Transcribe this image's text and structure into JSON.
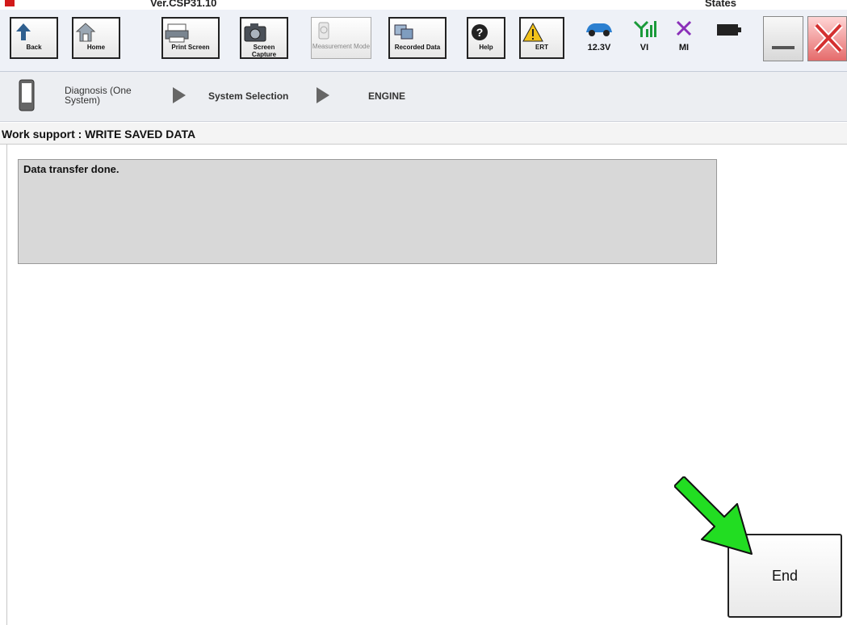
{
  "titlebar": {
    "version": "Ver.CSP31.10",
    "states": "States"
  },
  "toolbar": {
    "back": "Back",
    "home": "Home",
    "print_screen": "Print Screen",
    "screen_capture": "Screen Capture",
    "measurement_mode": "Measurement Mode",
    "recorded_data": "Recorded Data",
    "help": "Help",
    "ert": "ERT",
    "battery_voltage": "12.3V",
    "vi": "VI",
    "mi": "MI"
  },
  "breadcrumb": {
    "step1": "Diagnosis (One System)",
    "step2": "System Selection",
    "step3": "ENGINE"
  },
  "work_support": {
    "title": "Work support : WRITE SAVED DATA"
  },
  "message": {
    "text": "Data transfer done."
  },
  "end_button": {
    "label": "End"
  },
  "colors": {
    "accent_arrow": "#22dd22",
    "close_red": "#e03030",
    "vi_green": "#1a9a3a",
    "mi_purple": "#8a2fb8"
  }
}
